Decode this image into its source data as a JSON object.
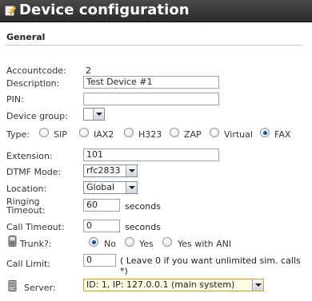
{
  "header": {
    "title": "Device configuration"
  },
  "section": {
    "title": "General"
  },
  "fields": {
    "accountcode": {
      "label": "Accountcode:",
      "value": "2"
    },
    "description": {
      "label": "Description:",
      "value": "Test Device #1"
    },
    "pin": {
      "label": "PIN:",
      "value": ""
    },
    "device_group": {
      "label": "Device group:",
      "value": ""
    },
    "type": {
      "label": "Type:",
      "options": [
        "SIP",
        "IAX2",
        "H323",
        "ZAP",
        "Virtual",
        "FAX"
      ],
      "selected": "FAX"
    },
    "extension": {
      "label": "Extension:",
      "value": "101"
    },
    "dtmf_mode": {
      "label": "DTMF Mode:",
      "value": "rfc2833"
    },
    "location": {
      "label": "Location:",
      "value": "Global"
    },
    "ringing_timeout": {
      "label_line1": "Ringing",
      "label_line2": "Timeout:",
      "value": "60",
      "unit": "seconds"
    },
    "call_timeout": {
      "label": "Call Timeout:",
      "value": "0",
      "unit": "seconds"
    },
    "trunk": {
      "label": "Trunk?:",
      "options": [
        "No",
        "Yes",
        "Yes with ANI"
      ],
      "selected": "No"
    },
    "call_limit": {
      "label": "Call Limit:",
      "value": "0",
      "note": "( Leave 0 if you want unlimited sim. calls",
      "note_line2": "*)"
    },
    "server": {
      "label": "Server:",
      "value": "ID: 1, IP: 127.0.0.1 (main system)"
    }
  },
  "icons": {
    "title_icon": "pencil-icon",
    "trunk_icon": "phone-icon",
    "server_icon": "server-icon"
  },
  "colors": {
    "title_bg": "#333333",
    "radio_dot": "#1a4f9c"
  }
}
